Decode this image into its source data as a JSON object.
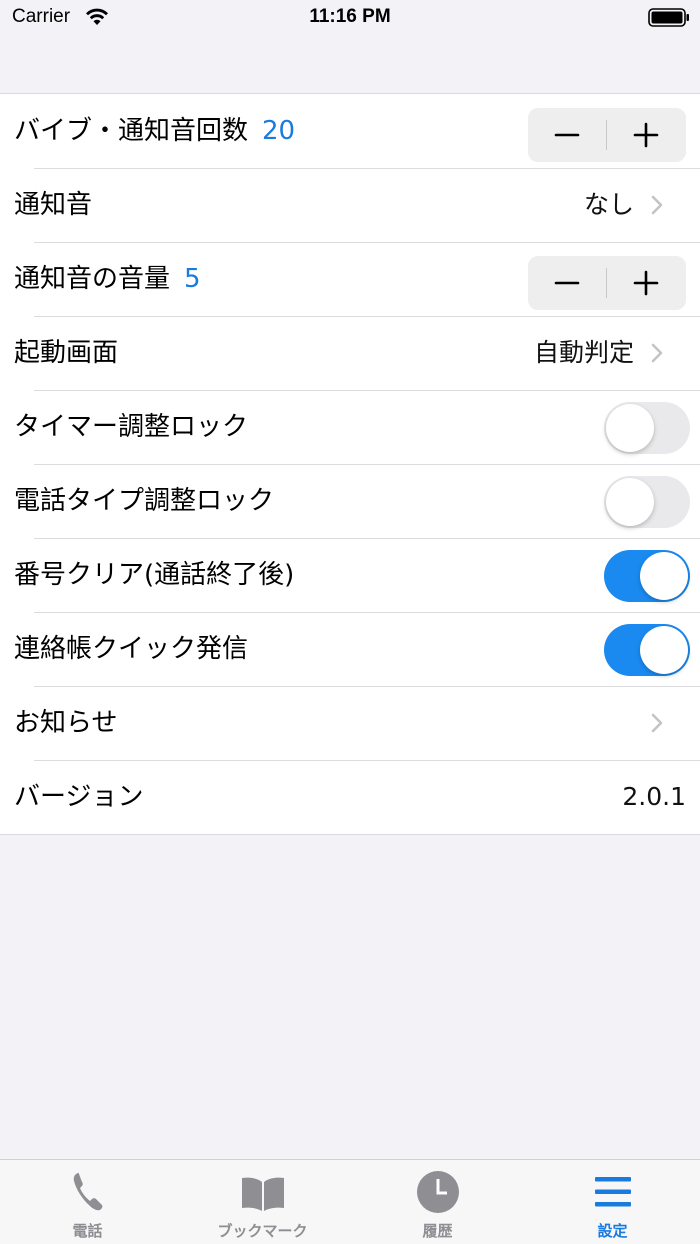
{
  "status_bar": {
    "carrier": "Carrier",
    "time": "11:16 PM"
  },
  "settings": [
    {
      "label": "バイブ・通知音回数",
      "number": "20",
      "control": "stepper"
    },
    {
      "label": "通知音",
      "value": "なし",
      "control": "disclosure"
    },
    {
      "label": "通知音の音量",
      "number": "5",
      "control": "stepper"
    },
    {
      "label": "起動画面",
      "value": "自動判定",
      "control": "disclosure"
    },
    {
      "label": "タイマー調整ロック",
      "control": "toggle",
      "on": false
    },
    {
      "label": "電話タイプ調整ロック",
      "control": "toggle",
      "on": false
    },
    {
      "label": "番号クリア(通話終了後)",
      "control": "toggle",
      "on": true
    },
    {
      "label": "連絡帳クイック発信",
      "control": "toggle",
      "on": true
    },
    {
      "label": "お知らせ",
      "control": "disclosure"
    },
    {
      "label": "バージョン",
      "value": "2.0.1",
      "control": "static"
    }
  ],
  "tabs": [
    {
      "label": "電話",
      "icon": "phone-icon"
    },
    {
      "label": "ブックマーク",
      "icon": "book-icon"
    },
    {
      "label": "履歴",
      "icon": "clock-icon"
    },
    {
      "label": "設定",
      "icon": "menu-icon",
      "active": true
    }
  ],
  "colors": {
    "accent": "#1a7bde",
    "toggle_on": "#1a8af0",
    "inactive_tab": "#8e8e93"
  }
}
